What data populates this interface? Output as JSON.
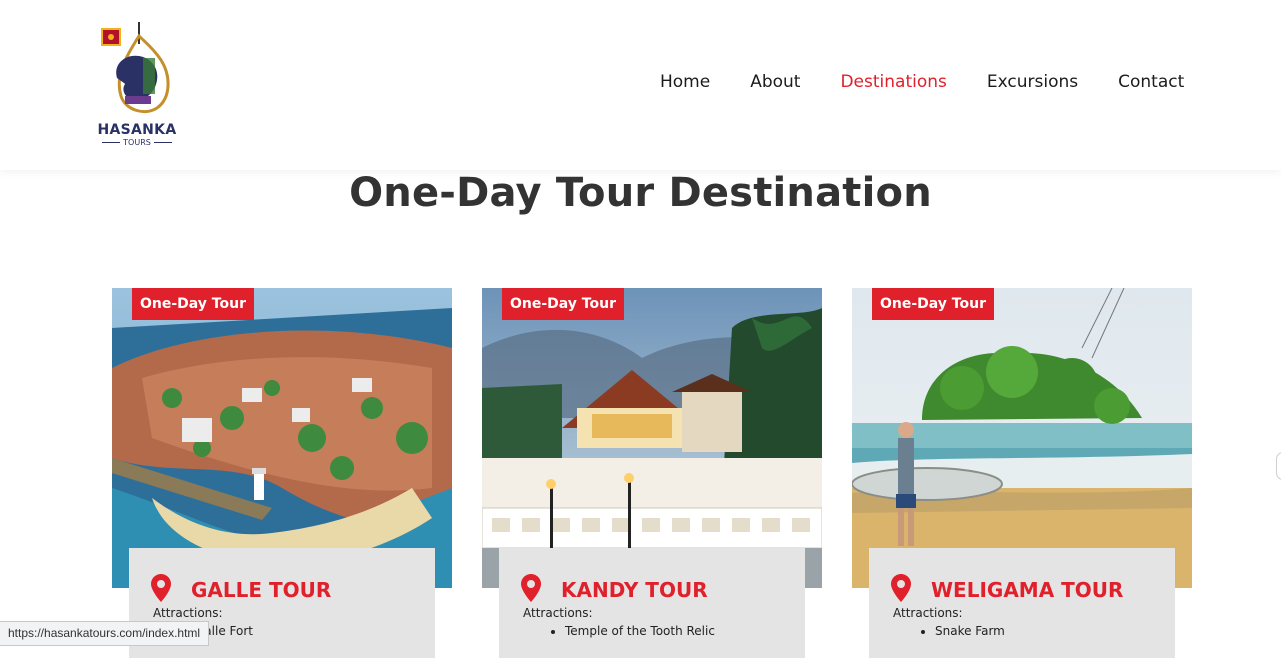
{
  "brand": {
    "name": "HASANKA",
    "subtitle": "TOURS"
  },
  "nav": {
    "items": [
      "Home",
      "About",
      "Destinations",
      "Excursions",
      "Contact"
    ],
    "active": "Destinations"
  },
  "page": {
    "title": "One-Day Tour Destination"
  },
  "cards": [
    {
      "tag": "One-Day Tour",
      "title": "GALLE TOUR",
      "attractions_label": "Attractions:",
      "attractions": [
        "Galle Fort"
      ]
    },
    {
      "tag": "One-Day Tour",
      "title": "KANDY TOUR",
      "attractions_label": "Attractions:",
      "attractions": [
        "Temple of the Tooth Relic"
      ]
    },
    {
      "tag": "One-Day Tour",
      "title": "WELIGAMA TOUR",
      "attractions_label": "Attractions:",
      "attractions": [
        "Snake Farm"
      ]
    }
  ],
  "status_bar": {
    "url": "https://hasankatours.com/index.html"
  },
  "colors": {
    "accent": "#e0202b",
    "text": "#333333",
    "card_bg": "#e4e4e4",
    "brand_navy": "#2a3165"
  }
}
